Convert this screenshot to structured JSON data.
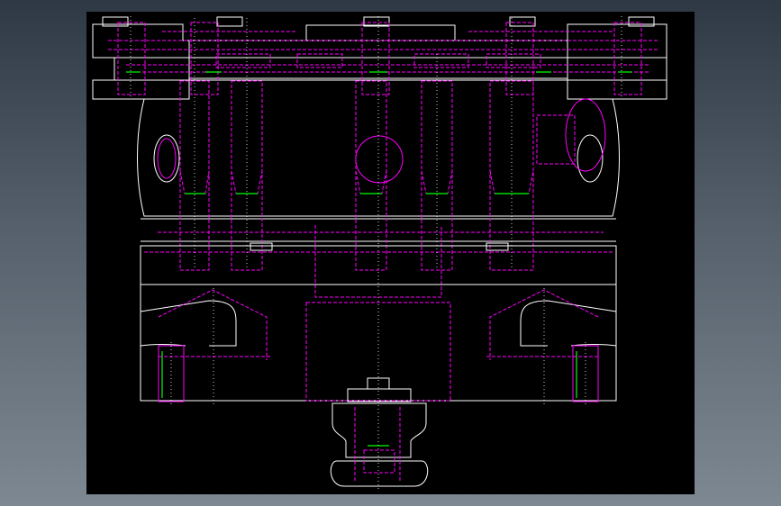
{
  "viewer": {
    "background": "#2f3945",
    "canvas_color": "#000000"
  },
  "drawing": {
    "subject": "die-set-assembly-front-view",
    "colors": {
      "outline": "#ffffff",
      "hidden": "#ff00ff",
      "accent": "#00ff00",
      "centerline": "#ffffff"
    }
  }
}
